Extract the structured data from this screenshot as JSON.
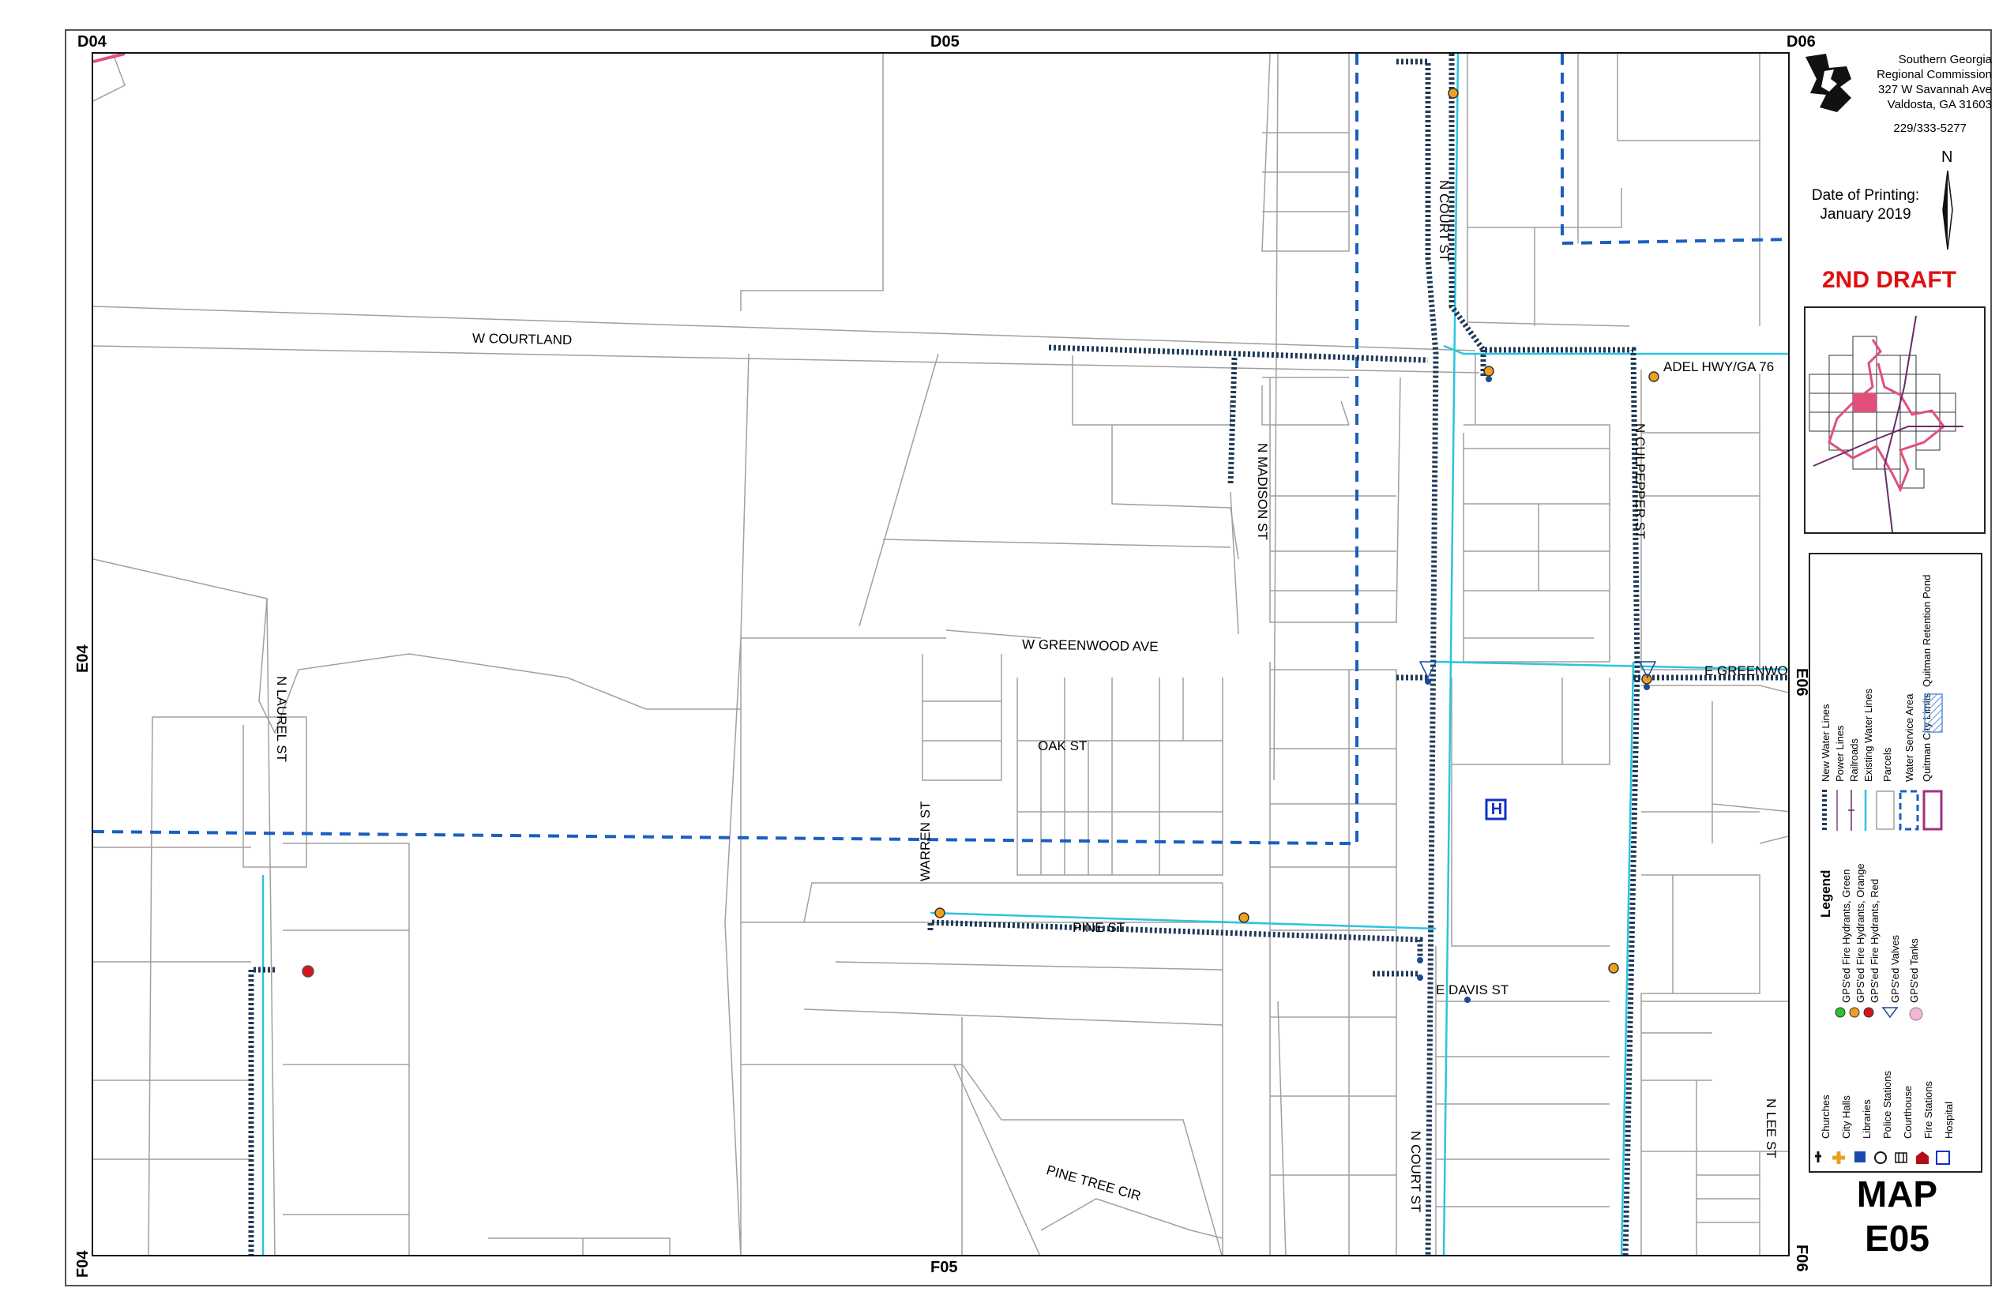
{
  "grid": {
    "top_left": "D04",
    "top_center": "D05",
    "top_right": "D06",
    "left_mid": "E04",
    "left_bottom": "F04",
    "bottom_center": "F05",
    "right_mid": "E06",
    "right_bottom": "F06"
  },
  "streets": {
    "w_courtland": "W COURTLAND",
    "n_court_st_top": "N COURT ST",
    "n_court_st_bottom": "N COURT ST",
    "n_madison_st": "N MADISON ST",
    "adel_hwy": "ADEL HWY/GA 76",
    "n_culpepper_st": "N CULPEPPER ST",
    "w_greenwood_ave": "W GREENWOOD AVE",
    "e_greenwood": "E GREENWOOD",
    "oak_st": "OAK ST",
    "n_laurel_st": "N LAUREL ST",
    "warren_st": "WARREN ST",
    "pine_st": "PINE ST",
    "e_davis_st": "E DAVIS ST",
    "pine_tree_cir": "PINE TREE CIR",
    "n_lee_st": "N LEE ST"
  },
  "hospital_symbol": "H",
  "sidebar": {
    "org_line1": "Southern Georgia",
    "org_line2": "Regional Commission",
    "org_line3": "327 W Savannah Ave",
    "org_line4": "Valdosta, GA  31603",
    "phone": "229/333-5277",
    "north": "N",
    "date_label": "Date of Printing:",
    "date_value": "January 2019",
    "draft": "2ND DRAFT",
    "map_word": "MAP",
    "map_id": "E05"
  },
  "legend": {
    "title": "Legend",
    "items": [
      {
        "label": "Churches",
        "icon": "church-icon"
      },
      {
        "label": "City Halls",
        "icon": "city-hall-icon"
      },
      {
        "label": "Libraries",
        "icon": "library-icon"
      },
      {
        "label": "Police Stations",
        "icon": "police-icon"
      },
      {
        "label": "Courthouse",
        "icon": "courthouse-icon"
      },
      {
        "label": "Fire Stations",
        "icon": "fire-station-icon"
      },
      {
        "label": "Hospital",
        "icon": "hospital-icon"
      },
      {
        "label": "GPS'ed Fire Hydrants, Green",
        "icon": "hydrant-green-icon"
      },
      {
        "label": "GPS'ed Fire Hydrants, Orange",
        "icon": "hydrant-orange-icon"
      },
      {
        "label": "GPS'ed Fire Hydrants, Red",
        "icon": "hydrant-red-icon"
      },
      {
        "label": "GPS'ed Valves",
        "icon": "valve-icon"
      },
      {
        "label": "GPS'ed Tanks",
        "icon": "tank-icon"
      },
      {
        "label": "New Water Lines",
        "icon": "new-water-line-icon"
      },
      {
        "label": "Power Lines",
        "icon": "power-line-icon"
      },
      {
        "label": "Railroads",
        "icon": "railroad-icon"
      },
      {
        "label": "Existing Water Lines",
        "icon": "existing-water-line-icon"
      },
      {
        "label": "Parcels",
        "icon": "parcel-icon"
      },
      {
        "label": "Water Service Area",
        "icon": "service-area-icon"
      },
      {
        "label": "Quitman City Limits",
        "icon": "city-limits-icon"
      },
      {
        "label": "Quitman Retention Pond",
        "icon": "retention-pond-icon"
      }
    ]
  },
  "colors": {
    "new_water_line": "#1f3a56",
    "existing_water_line": "#2ec3e0",
    "service_area": "#1a5fc2",
    "parcel": "#9a9a9a",
    "hydrant_orange": "#f0a020",
    "hydrant_red": "#d8141c",
    "valve": "#1a4a9a",
    "city_limits": "#e0507a",
    "draft": "#dd1111"
  }
}
